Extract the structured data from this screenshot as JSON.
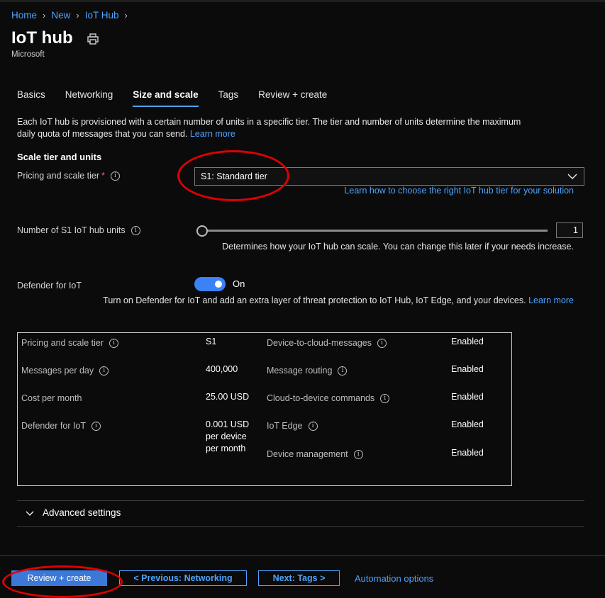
{
  "breadcrumb": [
    "Home",
    "New",
    "IoT Hub"
  ],
  "page": {
    "title": "IoT hub",
    "subtitle": "Microsoft"
  },
  "tabs": [
    "Basics",
    "Networking",
    "Size and scale",
    "Tags",
    "Review + create"
  ],
  "active_tab": "Size and scale",
  "description": {
    "text": "Each IoT hub is provisioned with a certain number of units in a specific tier. The tier and number of units determine the maximum daily quota of messages that you can send.",
    "link": "Learn more"
  },
  "scale": {
    "heading": "Scale tier and units",
    "pricing_label": "Pricing and scale tier",
    "pricing_required": "*",
    "pricing_value": "S1: Standard tier",
    "pricing_help_link": "Learn how to choose the right IoT hub tier for your solution",
    "units_label": "Number of S1 IoT hub units",
    "units_value": "1",
    "units_help": "Determines how your IoT hub can scale. You can change this later if your needs increase."
  },
  "defender": {
    "label": "Defender for IoT",
    "toggle_state": "On",
    "help": "Turn on Defender for IoT and add an extra layer of threat protection to IoT Hub, IoT Edge, and your devices.",
    "link": "Learn more"
  },
  "summary": {
    "left": [
      {
        "label": "Pricing and scale tier",
        "value": "S1"
      },
      {
        "label": "Messages per day",
        "value": "400,000"
      },
      {
        "label": "Cost per month",
        "value": "25.00 USD"
      },
      {
        "label": "Defender for IoT",
        "value": "0.001 USD per device per month"
      }
    ],
    "right": [
      {
        "label": "Device-to-cloud-messages",
        "value": "Enabled"
      },
      {
        "label": "Message routing",
        "value": "Enabled"
      },
      {
        "label": "Cloud-to-device commands",
        "value": "Enabled"
      },
      {
        "label": "IoT Edge",
        "value": "Enabled"
      },
      {
        "label": "Device management",
        "value": "Enabled"
      }
    ]
  },
  "advanced": {
    "label": "Advanced settings"
  },
  "footer": {
    "review_create": "Review + create",
    "previous": "< Previous: Networking",
    "next": "Next: Tags >",
    "automation": "Automation options"
  },
  "colors": {
    "accent": "#4da3ff",
    "primary_button": "#3b78d8",
    "annotation": "#e00000"
  }
}
